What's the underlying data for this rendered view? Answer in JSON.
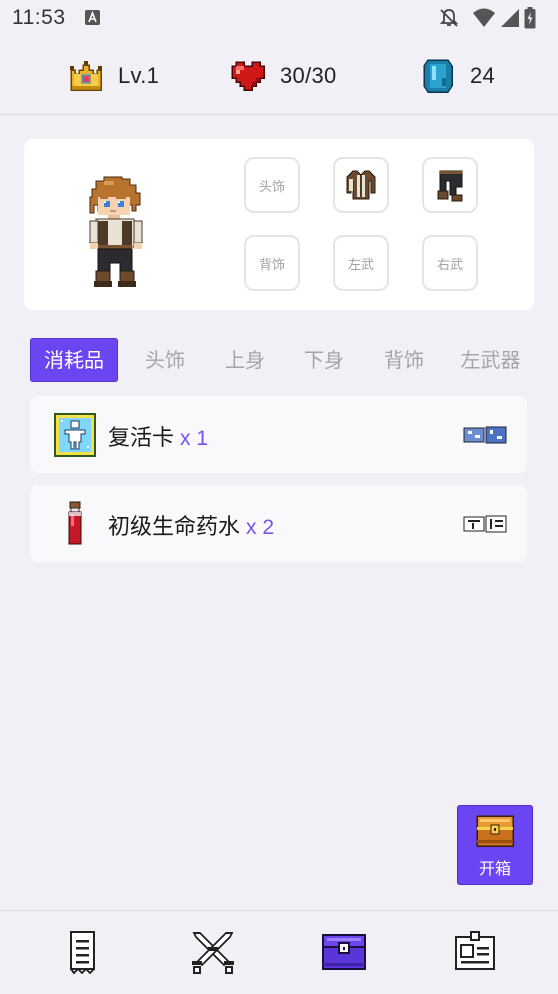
{
  "status_bar": {
    "time": "11:53",
    "icons": [
      "notification-a-icon",
      "bell-off-icon",
      "wifi-icon",
      "signal-icon",
      "battery-charging-icon"
    ]
  },
  "stats": {
    "level": "Lv.1",
    "hp": "30/30",
    "gems": "24",
    "icons": [
      "crown-icon",
      "heart-icon",
      "gem-icon"
    ]
  },
  "character": {
    "slots": [
      {
        "id": "head",
        "label": "头饰",
        "filled": false
      },
      {
        "id": "body",
        "label": "",
        "filled": true,
        "icon": "jacket-icon"
      },
      {
        "id": "legs",
        "label": "",
        "filled": true,
        "icon": "pants-icon"
      },
      {
        "id": "back",
        "label": "背饰",
        "filled": false
      },
      {
        "id": "left-weapon",
        "label": "左武",
        "filled": false
      },
      {
        "id": "right-weapon",
        "label": "右武",
        "filled": false
      }
    ]
  },
  "tabs": [
    {
      "label": "消耗品",
      "active": true
    },
    {
      "label": "头饰",
      "active": false
    },
    {
      "label": "上身",
      "active": false
    },
    {
      "label": "下身",
      "active": false
    },
    {
      "label": "背饰",
      "active": false
    },
    {
      "label": "左武器",
      "active": false
    }
  ],
  "items": [
    {
      "name": "复活卡",
      "qty": "x 1",
      "icon": "revive-card-icon",
      "action_icon": "pixel-glyph-blue-icon"
    },
    {
      "name": "初级生命药水",
      "qty": "x 2",
      "icon": "health-potion-icon",
      "action_icon": "pixel-glyph-dark-icon"
    }
  ],
  "open_chest": {
    "label": "开箱",
    "icon": "treasure-chest-icon"
  },
  "bottom_nav": [
    {
      "id": "log",
      "icon": "scroll-icon",
      "active": false
    },
    {
      "id": "battle",
      "icon": "crossed-swords-icon",
      "active": false
    },
    {
      "id": "inventory",
      "icon": "chest-icon",
      "active": true
    },
    {
      "id": "profile",
      "icon": "id-card-icon",
      "active": false
    }
  ],
  "colors": {
    "accent": "#6C45F2",
    "background": "#F1F0F6",
    "card": "#FFFFFF",
    "qty_text": "#7355E8"
  }
}
